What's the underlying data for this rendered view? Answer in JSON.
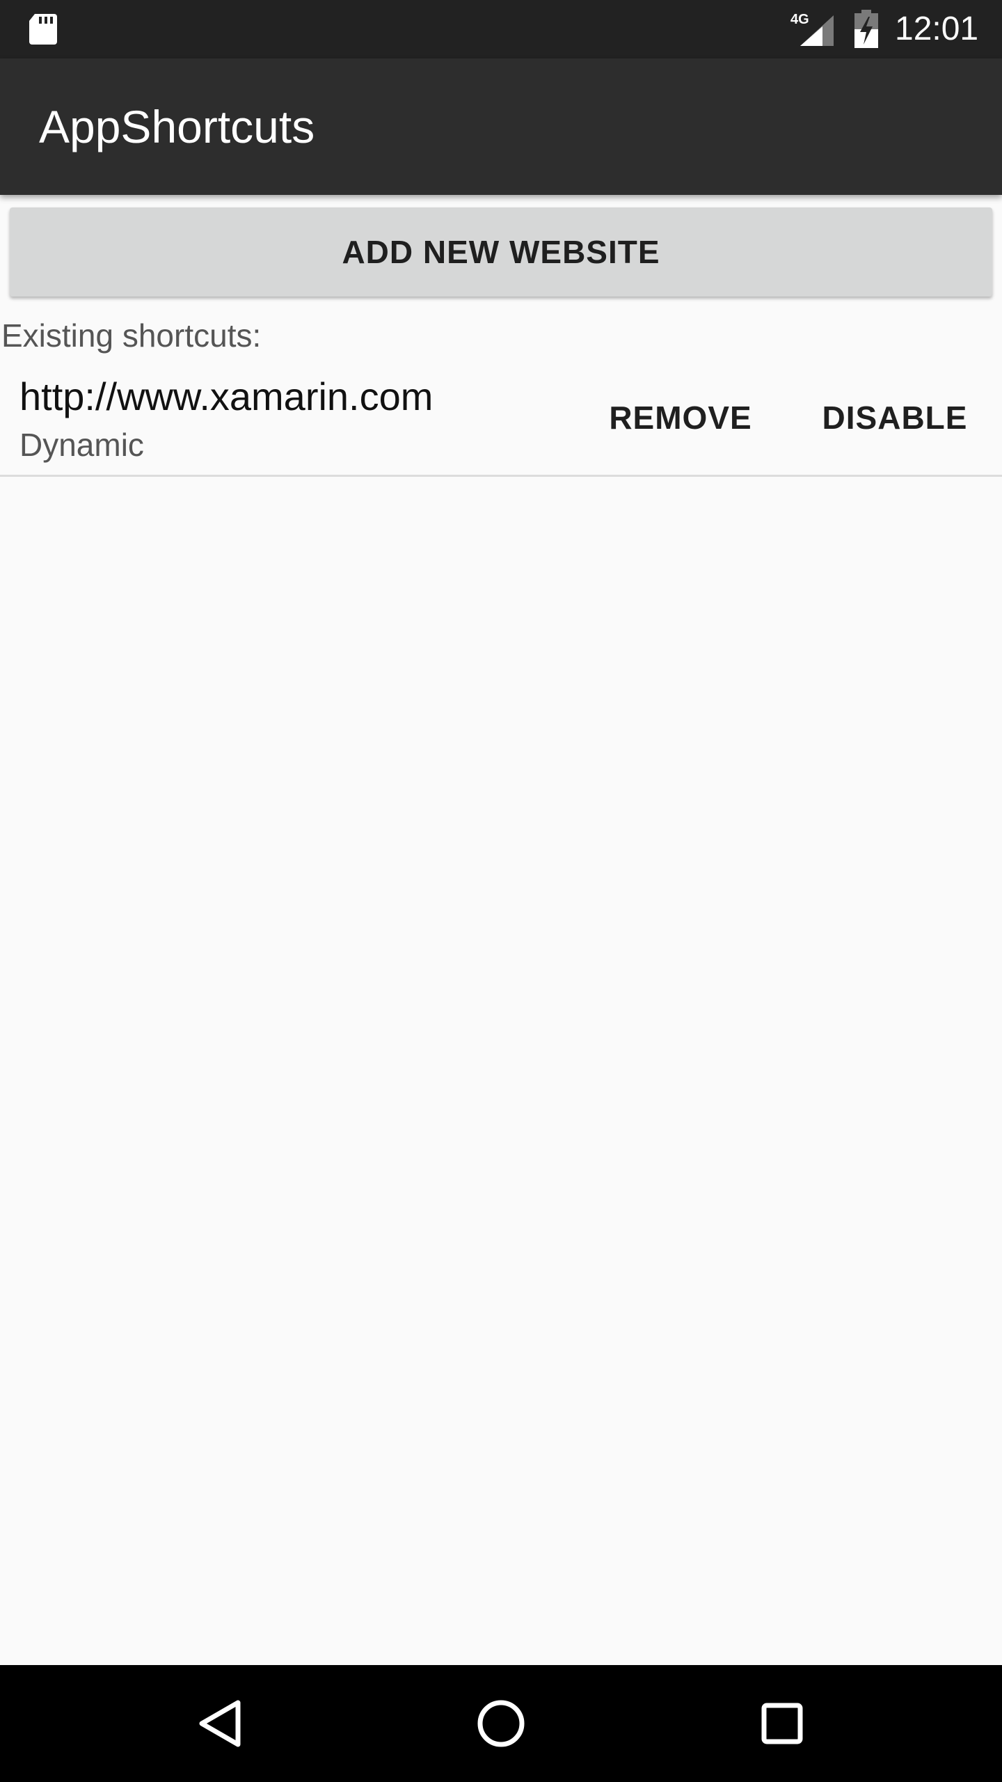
{
  "status_bar": {
    "time": "12:01",
    "network_label": "4G",
    "icons": [
      "sd-card-icon",
      "signal-icon",
      "battery-charging-icon"
    ]
  },
  "app_bar": {
    "title": "AppShortcuts"
  },
  "main": {
    "add_button_label": "ADD NEW WEBSITE",
    "existing_label": "Existing shortcuts:",
    "shortcuts": [
      {
        "url": "http://www.xamarin.com",
        "type": "Dynamic",
        "remove_label": "REMOVE",
        "disable_label": "DISABLE"
      }
    ]
  },
  "nav_bar": {
    "icons": [
      "back-icon",
      "home-icon",
      "recents-icon"
    ]
  },
  "colors": {
    "status_bar": "#222222",
    "app_bar": "#2d2d2d",
    "background": "#fafafa",
    "button": "#d6d7d7",
    "nav_bar": "#000000"
  }
}
